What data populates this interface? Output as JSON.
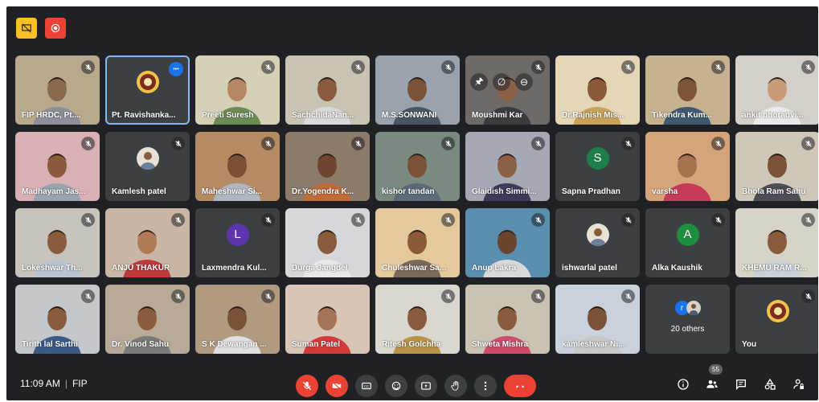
{
  "app": {
    "time": "11:09 AM",
    "meeting_code": "FIP",
    "participant_count": "55"
  },
  "participants": [
    {
      "name": "FIP HRDC, Pt....",
      "muted": true,
      "bg": "#b9a98c",
      "skin": "#8a6a4c",
      "shirt": "#8c8f98"
    },
    {
      "name": "Pt. Ravishanka...",
      "muted": false,
      "selected": true,
      "more": true,
      "bg": "#3c4043",
      "logo": true
    },
    {
      "name": "Preeti Suresh",
      "muted": true,
      "bg": "#d6d0b6",
      "skin": "#b48765",
      "shirt": "#6d8b55"
    },
    {
      "name": "SachchidaNan...",
      "muted": true,
      "bg": "#c9c3b3",
      "skin": "#8a5c3e",
      "shirt": "#d9d9d9"
    },
    {
      "name": "M.S.SONWANI",
      "muted": true,
      "bg": "#9aa3ad",
      "skin": "#7a5238",
      "shirt": "#4a5663"
    },
    {
      "name": "Moushmi Kar",
      "muted": true,
      "pinned": true,
      "bg": "#6f6a66",
      "skin": "#8c6247",
      "shirt": "#3b3c40"
    },
    {
      "name": "Dr.Rajnish Mis...",
      "muted": true,
      "bg": "#e5d6b8",
      "skin": "#8a5a3b",
      "shirt": "#c8a25a"
    },
    {
      "name": "Tikendra Kum...",
      "muted": true,
      "bg": "#c7b28f",
      "skin": "#7d5438",
      "shirt": "#3f5a6e"
    },
    {
      "name": "ankit bhoradvi...",
      "muted": true,
      "bg": "#d4cfc8",
      "skin": "#c79b7a",
      "shirt": "#eaeaea"
    },
    {
      "name": "Madhayam Jas...",
      "muted": true,
      "bg": "#d9b0b3",
      "skin": "#8b5a3c",
      "shirt": "#9aa4b0"
    },
    {
      "name": "Kamlesh patel",
      "muted": true,
      "bg": "#3c4043",
      "avatar_img": true
    },
    {
      "name": "Maheshwar Si...",
      "muted": true,
      "bg": "#b58b64",
      "skin": "#7a4f35",
      "shirt": "#b0b7c0"
    },
    {
      "name": "Dr.Yogendra K...",
      "muted": true,
      "bg": "#8c7a6a",
      "skin": "#6e4630",
      "shirt": "#c06b3a"
    },
    {
      "name": "kishor tandan",
      "muted": true,
      "bg": "#7a8a7e",
      "skin": "#7a5238",
      "shirt": "#5a6a7a"
    },
    {
      "name": "Glaidish Simmi...",
      "muted": true,
      "bg": "#a5a9b3",
      "skin": "#8a6046",
      "shirt": "#3e3a5a"
    },
    {
      "name": "Sapna Pradhan",
      "muted": true,
      "bg": "#3c4043",
      "letter": "S",
      "letter_color": "#1e7e4a"
    },
    {
      "name": "varsha",
      "muted": true,
      "bg": "#d6a47a",
      "skin": "#a57350",
      "shirt": "#c73b5a"
    },
    {
      "name": "Bhola Ram Sahu",
      "muted": true,
      "bg": "#cfc7b8",
      "skin": "#7a5238",
      "shirt": "#4d4d55"
    },
    {
      "name": "Lokeshwar Th...",
      "muted": true,
      "bg": "#c8c4bc",
      "skin": "#8a5c3e",
      "shirt": "#b8c4d0"
    },
    {
      "name": "ANJU THAKUR",
      "muted": true,
      "bg": "#c9b6a4",
      "skin": "#b07a56",
      "shirt": "#c03a3a"
    },
    {
      "name": "Laxmendra Kul...",
      "muted": true,
      "bg": "#3c4043",
      "letter": "L",
      "letter_color": "#5e35b1"
    },
    {
      "name": "Durga Jangdel",
      "muted": true,
      "bg": "#d5d7db",
      "skin": "#8a5c3e",
      "shirt": "#e8e8e8"
    },
    {
      "name": "Chuleshwar Sa...",
      "muted": true,
      "bg": "#e3c99c",
      "skin": "#8c5a38",
      "shirt": "#7a6a5a"
    },
    {
      "name": "Anup Lakra",
      "muted": true,
      "bg": "#5a8fb0",
      "skin": "#6b4530",
      "shirt": "#d9d9d9"
    },
    {
      "name": "ishwarlal patel",
      "muted": true,
      "bg": "#3c4043",
      "avatar_img": true
    },
    {
      "name": "Alka Kaushik",
      "muted": true,
      "bg": "#3c4043",
      "letter": "A",
      "letter_color": "#1e8e3e"
    },
    {
      "name": "KHEMU RAM R...",
      "muted": true,
      "bg": "#d8d3c8",
      "skin": "#8a5c3e",
      "shirt": "#c8d0d8"
    },
    {
      "name": "Tirith lal Sarthi",
      "muted": true,
      "bg": "#c4c8cc",
      "skin": "#8a5c3e",
      "shirt": "#3b5a8a"
    },
    {
      "name": "Dr. Vinod Sahu",
      "muted": true,
      "bg": "#b7aa96",
      "skin": "#8a5c3e",
      "shirt": "#7a7a7a"
    },
    {
      "name": "S K Dewangan ...",
      "muted": true,
      "bg": "#b09a80",
      "skin": "#7a5238",
      "shirt": "#e0e0e0"
    },
    {
      "name": "Suman Patel",
      "muted": false,
      "bg": "#d9c5b5",
      "skin": "#a57358",
      "shirt": "#d43a3a"
    },
    {
      "name": "Ritesh Golchha",
      "muted": true,
      "bg": "#d9d7cf",
      "skin": "#8a5c3e",
      "shirt": "#b8934a"
    },
    {
      "name": "Shweta Mishra",
      "muted": true,
      "bg": "#c9c3b3",
      "skin": "#8a5c3e",
      "shirt": "#d04a6a"
    },
    {
      "name": "kamleshwar Ni...",
      "muted": true,
      "bg": "#c9d1db",
      "skin": "#7a5238",
      "shirt": "#c8c8c8"
    },
    {
      "name": "20 others",
      "muted": false,
      "others": true,
      "bg": "#3c4043"
    },
    {
      "name": "You",
      "muted": true,
      "bg": "#3c4043",
      "logo": true
    }
  ],
  "others_avatars": [
    {
      "letter": "r",
      "color": "#1a73e8"
    },
    {
      "img": true
    }
  ],
  "controls": {
    "mic_icon": "mic-off-icon",
    "cam_icon": "camera-off-icon",
    "cc_icon": "captions-icon",
    "emoji_icon": "emoji-icon",
    "present_icon": "present-icon",
    "hand_icon": "raise-hand-icon",
    "more_icon": "more-options-icon",
    "end_icon": "end-call-icon"
  },
  "colors": {
    "bg": "#202124",
    "tile": "#3c4043",
    "red": "#ea4335",
    "accent": "#8ab4f8"
  }
}
